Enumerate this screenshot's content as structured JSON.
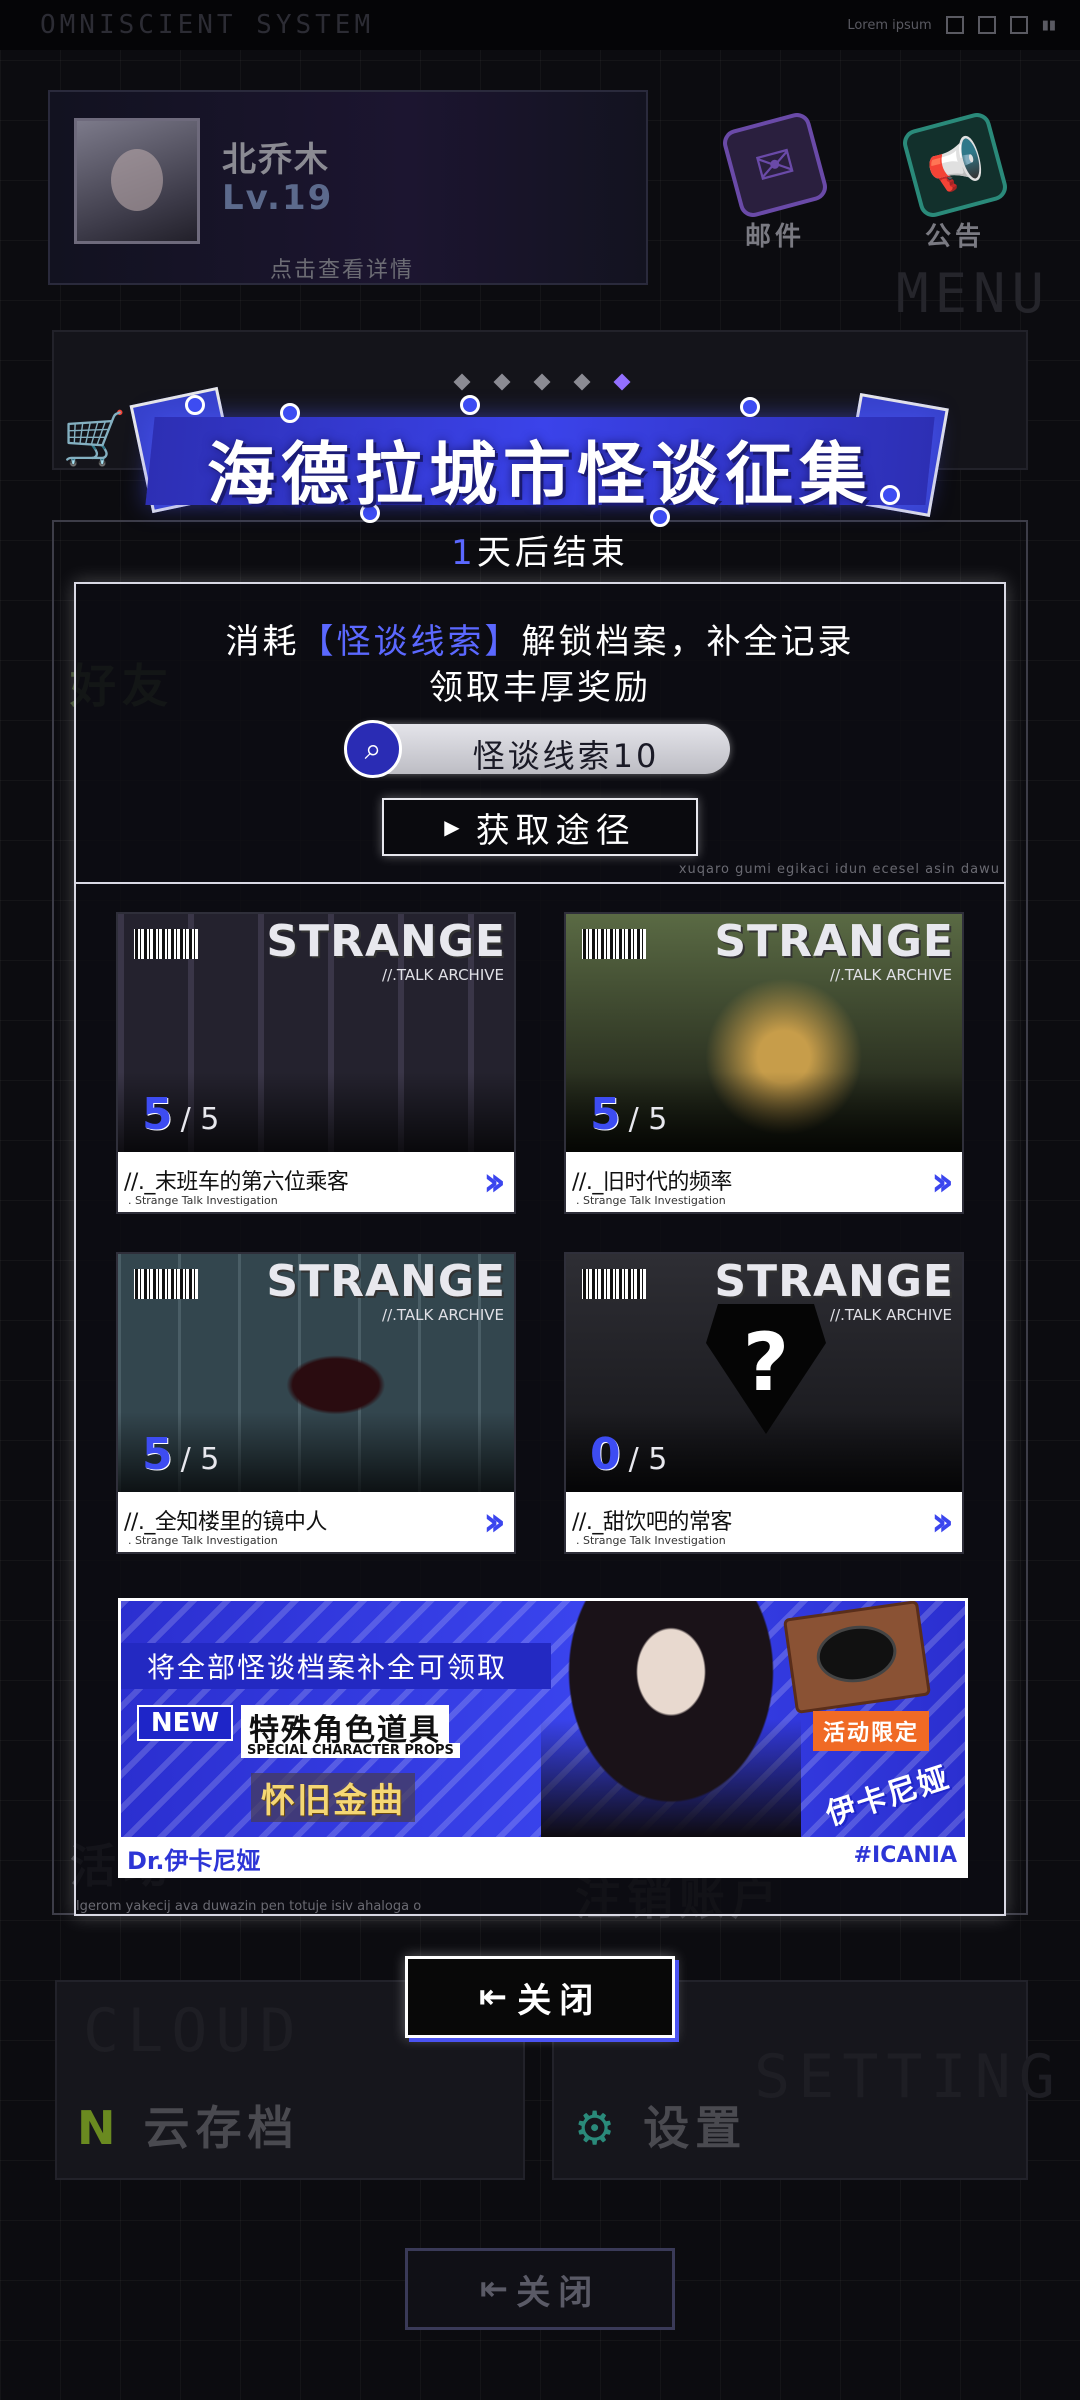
{
  "status_bar": {
    "system_title": "OMNISCIENT SYSTEM",
    "right_text": "Lorem ipsum"
  },
  "profile": {
    "name": "北乔木",
    "level": "Lv.19",
    "detail_hint": "点击查看详情"
  },
  "menu": {
    "mail_label": "邮件",
    "notice_label": "公告",
    "menu_word": "MENU"
  },
  "background_menu": {
    "friends_label": "好友",
    "cloud_big": "CLOUD",
    "cloud_label": "云存档",
    "setting_big": "SETTING",
    "setting_label": "设置",
    "logout_label": "注销账户",
    "activity_label": "活动",
    "close_label": "关闭"
  },
  "event": {
    "title": "海德拉城市怪谈征集",
    "countdown_number": "1",
    "countdown_text": "天后结束",
    "description_prefix": "消耗",
    "description_highlight": "【怪谈线索】",
    "description_suffix": "解锁档案，补全记录",
    "description_line2": "领取丰厚奖励",
    "clue_counter": "怪谈线索10",
    "acquire_button": "获取途径",
    "ticker_right": "xuqaro gumi egikaci idun ecesel asin dawu",
    "ticker_bottom": "lgerom yakecij ava duwazin pen totuje isiv ahaloga o",
    "carousel_total": 5,
    "carousel_active": 5
  },
  "cases": [
    {
      "title": "STRANGE",
      "subtitle": "//.TALK ARCHIVE",
      "progress_current": "5",
      "progress_total": "/ 5",
      "name": "//._末班车的第六位乘客",
      "name_en": ". Strange Talk Investigation",
      "scene": "subway"
    },
    {
      "title": "STRANGE",
      "subtitle": "//.TALK ARCHIVE",
      "progress_current": "5",
      "progress_total": "/ 5",
      "name": "//._旧时代的频率",
      "name_en": ". Strange Talk Investigation",
      "scene": "radio"
    },
    {
      "title": "STRANGE",
      "subtitle": "//.TALK ARCHIVE",
      "progress_current": "5",
      "progress_total": "/ 5",
      "name": "//._全知楼里的镜中人",
      "name_en": ". Strange Talk Investigation",
      "scene": "office"
    },
    {
      "title": "STRANGE",
      "subtitle": "//.TALK ARCHIVE",
      "progress_current": "0",
      "progress_total": "/ 5",
      "name": "//._甜饮吧的常客",
      "name_en": ". Strange Talk Investigation",
      "scene": "locked",
      "locked_mark": "?"
    }
  ],
  "reward": {
    "headline": "将全部怪谈档案补全可领取",
    "new_badge": "NEW",
    "item_type_cn": "特殊角色道具",
    "item_type_en": "SPECIAL CHARACTER PROPS",
    "item_name": "怀旧金曲",
    "limited_tag": "活动限定",
    "character_tag": "伊卡尼娅",
    "character_name": "Dr.伊卡尼娅",
    "hashtag": "#ICANIA"
  },
  "close_button": "关闭",
  "colors": {
    "accent_blue": "#3b45ee",
    "highlight_blue": "#5b68ff",
    "panel_border": "#d9d9e4",
    "reward_gold": "#f5d774",
    "limited_orange": "#f06a25"
  },
  "icons": {
    "cart": "shopping-cart-icon",
    "mail": "mail-icon",
    "notice": "megaphone-icon",
    "clue": "magnifier-icon",
    "close": "exit-icon"
  }
}
